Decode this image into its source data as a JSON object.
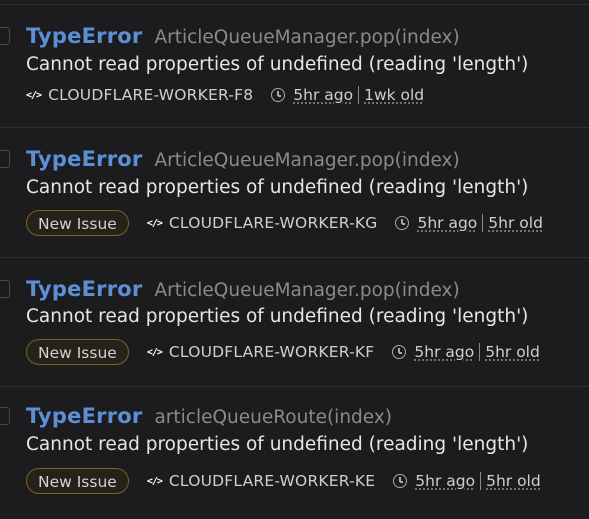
{
  "issues": [
    {
      "type": "TypeError",
      "culprit": "ArticleQueueManager.pop(index)",
      "message": "Cannot read properties of undefined (reading 'length')",
      "badge": "",
      "project": "CLOUDFLARE-WORKER-F8",
      "last_seen": "5hr ago",
      "age": "1wk old"
    },
    {
      "type": "TypeError",
      "culprit": "ArticleQueueManager.pop(index)",
      "message": "Cannot read properties of undefined (reading 'length')",
      "badge": "New Issue",
      "project": "CLOUDFLARE-WORKER-KG",
      "last_seen": "5hr ago",
      "age": "5hr old"
    },
    {
      "type": "TypeError",
      "culprit": "ArticleQueueManager.pop(index)",
      "message": "Cannot read properties of undefined (reading 'length')",
      "badge": "New Issue",
      "project": "CLOUDFLARE-WORKER-KF",
      "last_seen": "5hr ago",
      "age": "5hr old"
    },
    {
      "type": "TypeError",
      "culprit": "articleQueueRoute(index)",
      "message": "Cannot read properties of undefined (reading 'length')",
      "badge": "New Issue",
      "project": "CLOUDFLARE-WORKER-KE",
      "last_seen": "5hr ago",
      "age": "5hr old"
    }
  ],
  "icons": {
    "code": "code-icon",
    "clock": "clock-icon"
  },
  "colors": {
    "background": "#1c1c1e",
    "error_type": "#5b8fd6",
    "badge_border": "#7a6326"
  }
}
